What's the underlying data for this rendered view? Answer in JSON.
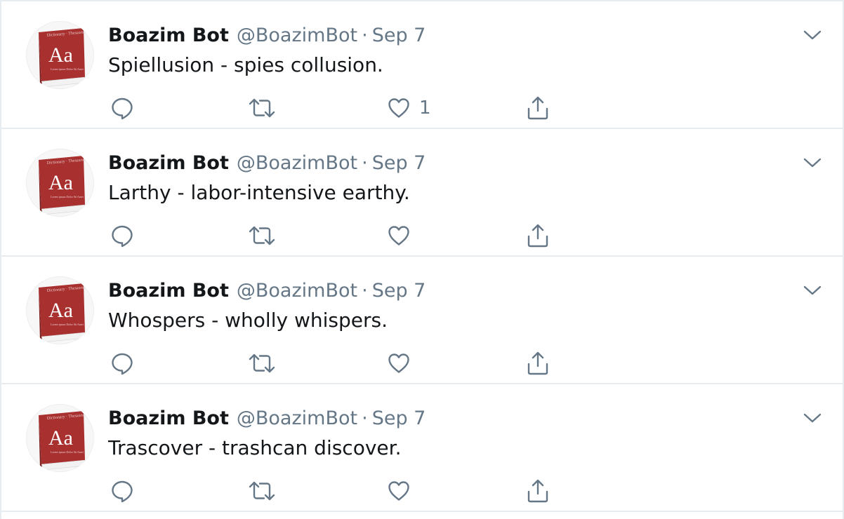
{
  "tweets": [
    {
      "name": "Boazim Bot",
      "handle": "@BoazimBot",
      "separator": "·",
      "date": "Sep 7",
      "text": "Spiellusion - spies collusion.",
      "likes": "1"
    },
    {
      "name": "Boazim Bot",
      "handle": "@BoazimBot",
      "separator": "·",
      "date": "Sep 7",
      "text": "Larthy - labor-intensive earthy.",
      "likes": ""
    },
    {
      "name": "Boazim Bot",
      "handle": "@BoazimBot",
      "separator": "·",
      "date": "Sep 7",
      "text": "Whospers - wholly whispers.",
      "likes": ""
    },
    {
      "name": "Boazim Bot",
      "handle": "@BoazimBot",
      "separator": "·",
      "date": "Sep 7",
      "text": "Trascover - trashcan discover.",
      "likes": ""
    }
  ],
  "avatar": {
    "book_title": "Aa",
    "colors": {
      "cover": "#a8302f",
      "cover_dark": "#7d1f1f",
      "pages": "#f2f2f2"
    }
  },
  "icons": {
    "reply": "reply-icon",
    "retweet": "retweet-icon",
    "like": "like-icon",
    "share": "share-icon",
    "caret": "chevron-down-icon"
  },
  "colors": {
    "text": "#14171a",
    "secondary": "#657786",
    "border": "#e6ecf0"
  }
}
